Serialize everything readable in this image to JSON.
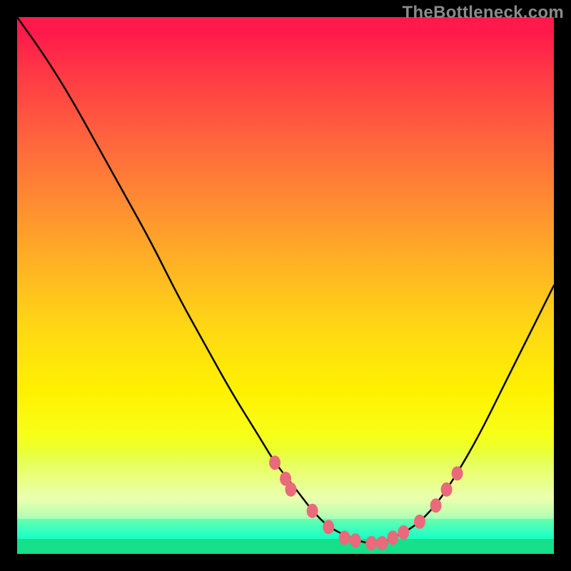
{
  "watermark": "TheBottleneck.com",
  "colors": {
    "gradient_top": "#ff1a4b",
    "gradient_mid": "#ffd814",
    "gradient_bottom": "#00ffc7",
    "curve_stroke": "#000000",
    "marker_fill": "#e96a7a",
    "green_strip": "#16e08a",
    "frame_black": "#000000"
  },
  "chart_data": {
    "type": "line",
    "title": "",
    "xlabel": "",
    "ylabel": "",
    "xlim": [
      0,
      100
    ],
    "ylim": [
      0,
      100
    ],
    "grid": false,
    "legend": false,
    "series": [
      {
        "name": "bottleneck-curve",
        "x": [
          0,
          5,
          10,
          15,
          20,
          25,
          30,
          35,
          40,
          45,
          48,
          52,
          55,
          58,
          62,
          65,
          68,
          70,
          74,
          78,
          82,
          86,
          90,
          94,
          98,
          100
        ],
        "y": [
          100,
          93,
          85,
          76,
          67,
          58,
          48,
          39,
          30,
          22,
          17,
          12,
          8,
          5,
          3,
          2,
          2,
          3,
          5,
          9,
          15,
          22,
          30,
          38,
          46,
          50
        ]
      }
    ],
    "markers": {
      "name": "highlight-points",
      "x": [
        48,
        50,
        51,
        55,
        58,
        61,
        63,
        66,
        68,
        70,
        72,
        75,
        78,
        80,
        82
      ],
      "y": [
        17,
        14,
        12,
        8,
        5,
        3,
        2.5,
        2,
        2,
        3,
        4,
        6,
        9,
        12,
        15
      ]
    },
    "annotations": [
      {
        "text": "TheBottleneck.com",
        "position": "top-right"
      }
    ]
  }
}
